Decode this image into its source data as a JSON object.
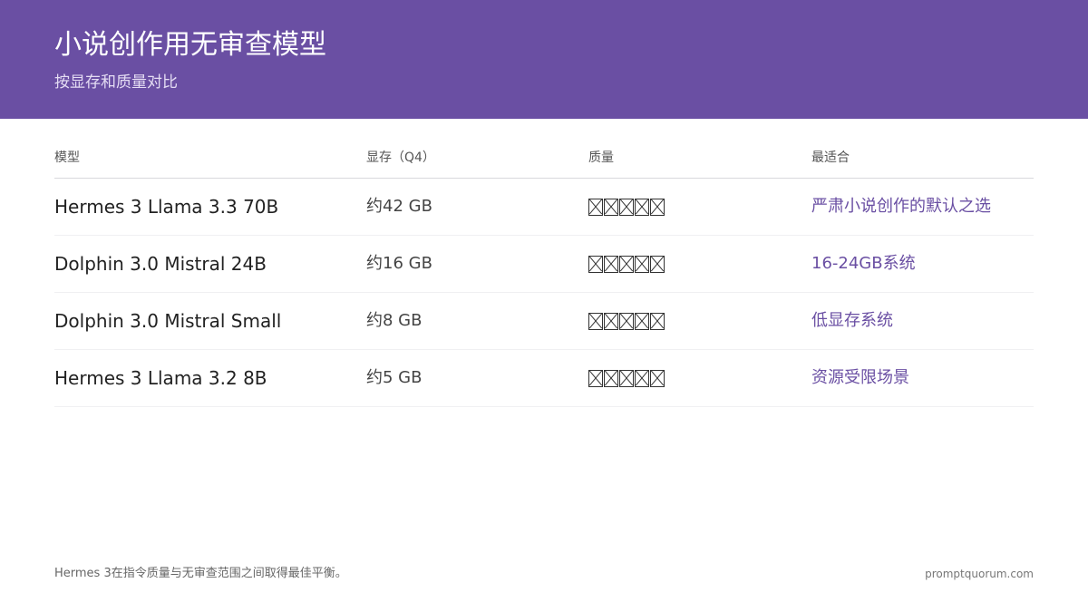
{
  "header": {
    "title": "小说创作用无审查模型",
    "subtitle": "按显存和质量对比",
    "background_color": "#6a4fa3"
  },
  "table": {
    "columns": [
      "模型",
      "显存（Q4）",
      "质量",
      "最适合"
    ],
    "rows": [
      {
        "model": "Hermes 3 Llama 3.3 70B",
        "vram": "约42 GB",
        "quality_glyphs": "☐☐☐☐☐",
        "best_for": "严肃小说创作的默认之选"
      },
      {
        "model": "Dolphin 3.0 Mistral 24B",
        "vram": "约16 GB",
        "quality_glyphs": "☐☐☐☐☐",
        "best_for": "16-24GB系统"
      },
      {
        "model": "Dolphin 3.0 Mistral Small",
        "vram": "约8 GB",
        "quality_glyphs": "☐☐☐☐☐",
        "best_for": "低显存系统"
      },
      {
        "model": "Hermes 3 Llama 3.2 8B",
        "vram": "约5 GB",
        "quality_glyphs": "☐☐☐☐☐",
        "best_for": "资源受限场景"
      }
    ],
    "accent_color": "#6a4fa3"
  },
  "footer": {
    "note": "Hermes 3在指令质量与无审查范围之间取得最佳平衡。",
    "site": "promptquorum.com"
  }
}
